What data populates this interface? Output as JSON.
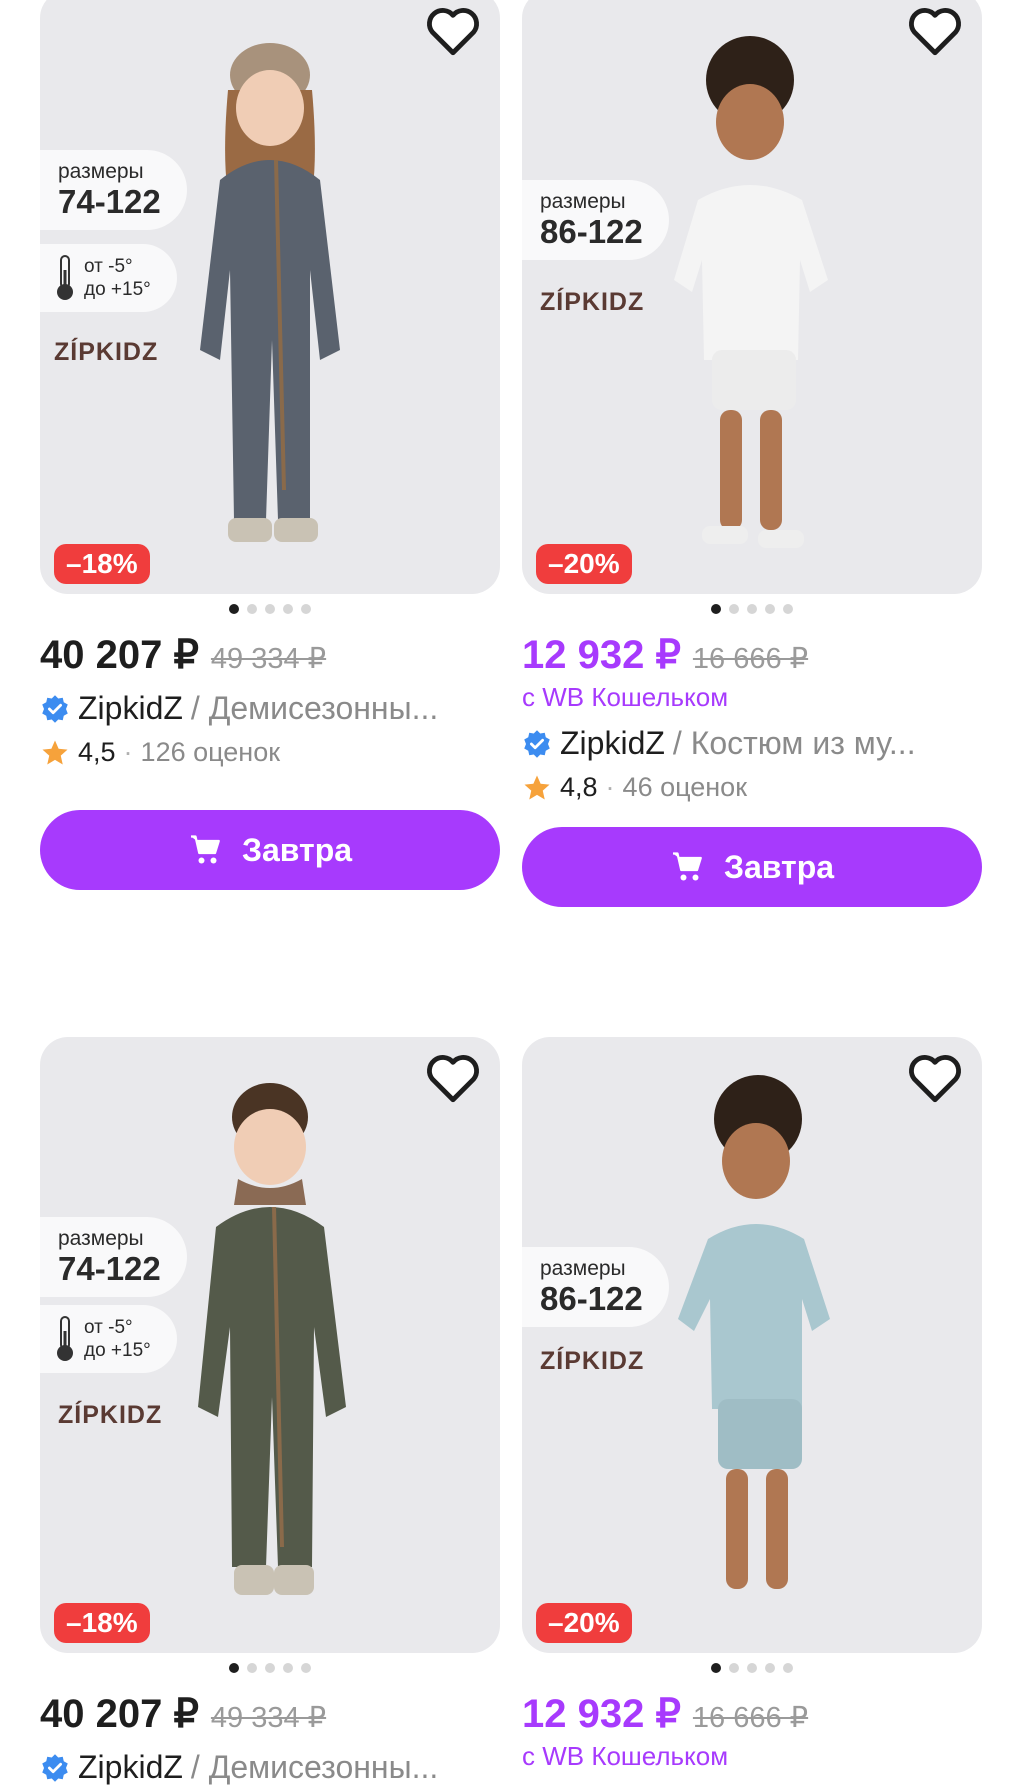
{
  "products": [
    {
      "sizes_label": "размеры",
      "sizes_value": "74-122",
      "temp_from": "от -5°",
      "temp_to": "до +15°",
      "brand_logo": "ZÍPKIDZ",
      "discount": "–18%",
      "price": "40 207 ₽",
      "old_price": "49 334 ₽",
      "seller": "ZipkidZ",
      "title": "/ Демисезонны...",
      "rating": "4,5",
      "reviews": "126 оценок",
      "button": "Завтра",
      "jacket_color": "#5a626e",
      "hat_color": "#a8927c"
    },
    {
      "sizes_label": "размеры",
      "sizes_value": "86-122",
      "brand_logo": "ZÍPKIDZ",
      "discount": "–20%",
      "price": "12 932 ₽",
      "old_price": "16 666 ₽",
      "wallet": "с WB Кошельком",
      "seller": "ZipkidZ",
      "title": "/ Костюм из му...",
      "rating": "4,8",
      "reviews": "46 оценок",
      "button": "Завтра",
      "outfit_color": "#f4f4f4"
    },
    {
      "sizes_label": "размеры",
      "sizes_value": "74-122",
      "temp_from": "от -5°",
      "temp_to": "до +15°",
      "brand_logo": "ZÍPKIDZ",
      "discount": "–18%",
      "price": "40 207 ₽",
      "old_price": "49 334 ₽",
      "seller": "ZipkidZ",
      "title": "/ Демисезонны...",
      "jacket_color": "#545a4a"
    },
    {
      "sizes_label": "размеры",
      "sizes_value": "86-122",
      "brand_logo": "ZÍPKIDZ",
      "discount": "–20%",
      "price": "12 932 ₽",
      "old_price": "16 666 ₽",
      "wallet": "с WB Кошельком",
      "outfit_color": "#a9c7cf"
    }
  ],
  "colors": {
    "accent": "#a73afd",
    "discount": "#f03d3d",
    "star": "#f6a23b",
    "verified": "#3c8cf0"
  }
}
